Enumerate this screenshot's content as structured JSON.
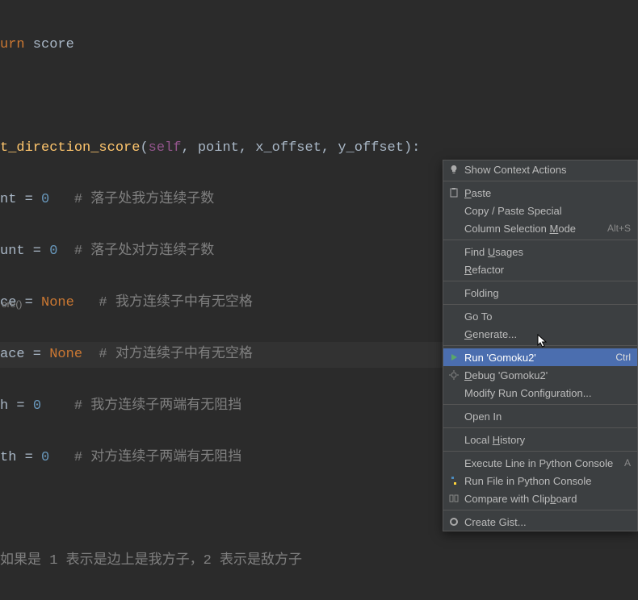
{
  "code": {
    "line1_a": "urn",
    "line1_b": " score",
    "line3_a": "t_direction_score",
    "line3_b": "(",
    "line3_c": "self",
    "line3_d": ", ",
    "line3_e": "point",
    "line3_f": ", ",
    "line3_g": "x_offset",
    "line3_h": ", ",
    "line3_i": "y_offset",
    "line3_j": "):",
    "line4_a": "nt = ",
    "line4_b": "0",
    "line4_c": "   # 落子处我方连续子数",
    "line5_a": "unt = ",
    "line5_b": "0",
    "line5_c": "  # 落子处对方连续子数",
    "line6_a": "ce = ",
    "line6_b": "None",
    "line6_c": "   # 我方连续子中有无空格",
    "line7_a": "ace = ",
    "line7_b": "None",
    "line7_c": "  # 对方连续子中有无空格",
    "line8_a": "h = ",
    "line8_b": "0",
    "line8_c": "    # 我方连续子两端有无阻挡",
    "line9_a": "th = ",
    "line9_b": "0",
    "line9_c": "   # 对方连续子两端有无阻挡",
    "line11_a": "如果是 ",
    "line11_b": "1",
    "line11_c": " 表示是边上是我方子，",
    "line11_d": "2",
    "line11_e": " 表示是敌方子"
  },
  "breadcrumb": "ore()",
  "menu": {
    "show_context": "Show Context Actions",
    "paste": "aste",
    "paste_u": "P",
    "copy_paste": "Copy / Paste Special",
    "column_a": "Column Selection ",
    "column_u": "M",
    "column_b": "ode",
    "column_sc": "Alt+S",
    "find_a": "Find ",
    "find_u": "U",
    "find_b": "sages",
    "refactor_u": "R",
    "refactor_b": "efactor",
    "folding": "Folding",
    "goto": "Go To",
    "generate_u": "G",
    "generate_b": "enerate...",
    "run": "Run 'Gomoku2'",
    "run_sc": "Ctrl",
    "debug_u": "D",
    "debug_b": "ebug 'Gomoku2'",
    "modify": "Modify Run Configuration...",
    "open_in": "Open In",
    "local_a": "Local ",
    "local_u": "H",
    "local_b": "istory",
    "exec_line": "Execute Line in Python Console",
    "exec_sc": "A",
    "run_file": "Run File in Python Console",
    "compare_a": "Compare with Clip",
    "compare_u": "b",
    "compare_b": "oard",
    "gist": "Create Gist..."
  }
}
